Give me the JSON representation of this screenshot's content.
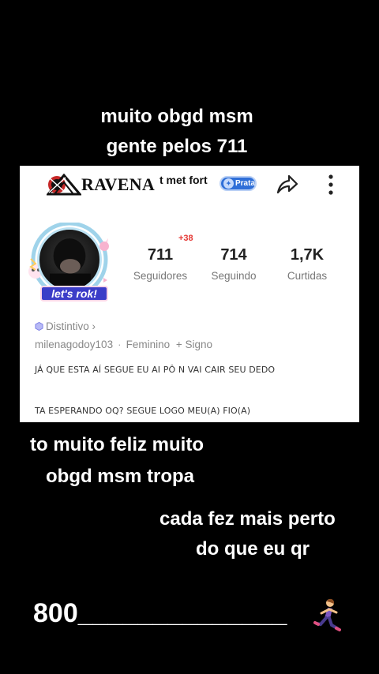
{
  "captions": {
    "top_line1": "muito obgd msm",
    "top_line2": "gente pelos 711",
    "mid_line1": "to muito feliz muito",
    "mid_line2": "obgd msm tropa",
    "right_line1": "cada fez mais perto",
    "right_line2": "do que eu qr",
    "bottom": "800______________"
  },
  "profile": {
    "display_name": "RAVENA",
    "name_suffix": "t met fort",
    "rank_badge": "Prata",
    "avatar_badge_text": "let's rok!",
    "stats": {
      "followers_value": "711",
      "followers_delta": "+38",
      "followers_label": "Seguidores",
      "following_value": "714",
      "following_label": "Seguindo",
      "likes_value": "1,7K",
      "likes_label": "Curtidas"
    },
    "distintivo_label": "Distintivo ›",
    "username": "milenagodoy103",
    "separator": "·",
    "gender": "Feminino",
    "signo_label": "+ Signo",
    "bio_line1": "JÁ QUE ESTA  AÍ SEGUE EU AI PÔ N VAI CAIR SEU DEDO",
    "bio_line2": "TA ESPERANDO OQ? SEGUE LOGO MEU(A) FIO(A)"
  },
  "icons": {
    "logo": "triangle-logo-icon",
    "share": "share-arrow-icon",
    "more": "more-vertical-icon",
    "distintivo": "hexagon-badge-icon",
    "runner": "running-woman-icon"
  },
  "colors": {
    "background": "#000000",
    "card": "#ffffff",
    "delta_red": "#e53935",
    "prata_blue": "#2f6fd8",
    "badge_purple": "#3b3dc8"
  }
}
